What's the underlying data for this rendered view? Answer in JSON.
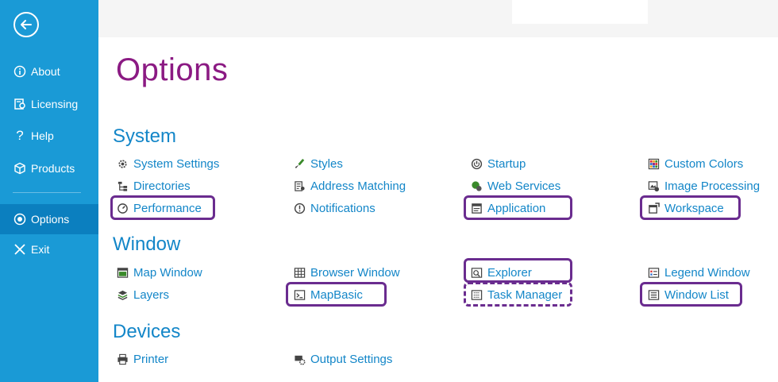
{
  "sidebar": {
    "back_icon": "back-arrow-icon",
    "items": [
      {
        "label": "About",
        "icon": "info-icon"
      },
      {
        "label": "Licensing",
        "icon": "license-icon"
      },
      {
        "label": "Help",
        "icon": "question-icon"
      },
      {
        "label": "Products",
        "icon": "cube-icon"
      },
      {
        "label": "Options",
        "icon": "radio-selected-icon",
        "active": true
      },
      {
        "label": "Exit",
        "icon": "close-icon"
      }
    ],
    "colors": {
      "background": "#1a9ad6",
      "active": "#0b7fbf"
    }
  },
  "page": {
    "title": "Options",
    "title_color": "#8b1a83",
    "link_color": "#1386c8",
    "highlight_color": "#6a2c8f"
  },
  "sections": {
    "system": {
      "title": "System",
      "items": [
        {
          "label": "System Settings",
          "icon": "gear-icon"
        },
        {
          "label": "Directories",
          "icon": "folder-tree-icon"
        },
        {
          "label": "Performance",
          "icon": "gauge-icon",
          "highlighted": true
        },
        {
          "label": "Styles",
          "icon": "paint-brush-icon"
        },
        {
          "label": "Address Matching",
          "icon": "address-match-icon"
        },
        {
          "label": "Notifications",
          "icon": "alert-icon"
        },
        {
          "label": "Startup",
          "icon": "power-icon"
        },
        {
          "label": "Web Services",
          "icon": "globe-icon"
        },
        {
          "label": "Application",
          "icon": "application-icon",
          "highlighted": true
        },
        {
          "label": "Custom Colors",
          "icon": "color-grid-icon"
        },
        {
          "label": "Image Processing",
          "icon": "image-icon"
        },
        {
          "label": "Workspace",
          "icon": "workspace-icon",
          "highlighted": true
        }
      ]
    },
    "window": {
      "title": "Window",
      "items": [
        {
          "label": "Map Window",
          "icon": "map-window-icon"
        },
        {
          "label": "Layers",
          "icon": "layers-icon"
        },
        {
          "label": "Browser Window",
          "icon": "table-icon"
        },
        {
          "label": "MapBasic",
          "icon": "console-icon",
          "highlighted": true
        },
        {
          "label": "Explorer",
          "icon": "explorer-icon",
          "highlighted": true
        },
        {
          "label": "Task Manager",
          "icon": "task-list-icon",
          "highlighted": "dashed"
        },
        {
          "label": "Legend Window",
          "icon": "legend-icon"
        },
        {
          "label": "Window List",
          "icon": "window-list-icon",
          "highlighted": true
        }
      ]
    },
    "devices": {
      "title": "Devices",
      "items": [
        {
          "label": "Printer",
          "icon": "printer-icon"
        },
        {
          "label": "Output Settings",
          "icon": "output-settings-icon"
        }
      ]
    }
  }
}
